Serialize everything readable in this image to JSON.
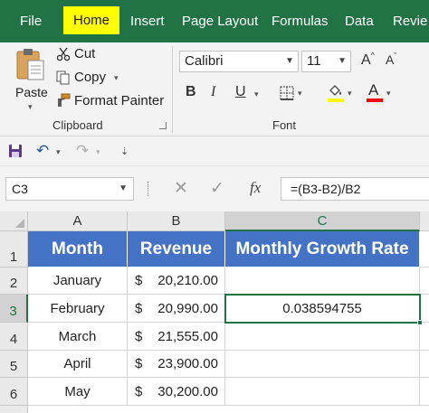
{
  "menu": {
    "tabs": [
      {
        "label": "File"
      },
      {
        "label": "Home"
      },
      {
        "label": "Insert"
      },
      {
        "label": "Page Layout"
      },
      {
        "label": "Formulas"
      },
      {
        "label": "Data"
      },
      {
        "label": "Revie"
      }
    ],
    "active_tab": "Home",
    "active_highlight_color": "#ffff00",
    "bar_color": "#217346"
  },
  "ribbon": {
    "clipboard": {
      "paste_label": "Paste",
      "cut_label": "Cut",
      "copy_label": "Copy",
      "format_painter_label": "Format Painter",
      "group_label": "Clipboard"
    },
    "font": {
      "font_name": "Calibri",
      "font_size": "11",
      "bold_label": "B",
      "italic_label": "I",
      "underline_label": "U",
      "grow_label": "A",
      "shrink_label": "A",
      "font_color_label": "A",
      "group_label": "Font",
      "highlight_color": "#ffff00",
      "font_color": "#ff0000"
    }
  },
  "formula_bar": {
    "name_box": "C3",
    "fx_label": "fx",
    "formula": "=(B3-B2)/B2"
  },
  "sheet": {
    "columns": [
      "A",
      "B",
      "C"
    ],
    "selected_column": "C",
    "rows": [
      "1",
      "2",
      "3",
      "4",
      "5",
      "6"
    ],
    "selected_row": "3",
    "header": {
      "month": "Month",
      "revenue": "Revenue",
      "growth": "Monthly Growth Rate"
    },
    "header_fill": "#4472c4",
    "data": [
      {
        "month": "January",
        "currency": "$",
        "revenue": "20,210.00",
        "growth": ""
      },
      {
        "month": "February",
        "currency": "$",
        "revenue": "20,990.00",
        "growth": "0.038594755"
      },
      {
        "month": "March",
        "currency": "$",
        "revenue": "21,555.00",
        "growth": ""
      },
      {
        "month": "April",
        "currency": "$",
        "revenue": "23,900.00",
        "growth": ""
      },
      {
        "month": "May",
        "currency": "$",
        "revenue": "30,200.00",
        "growth": ""
      }
    ]
  }
}
